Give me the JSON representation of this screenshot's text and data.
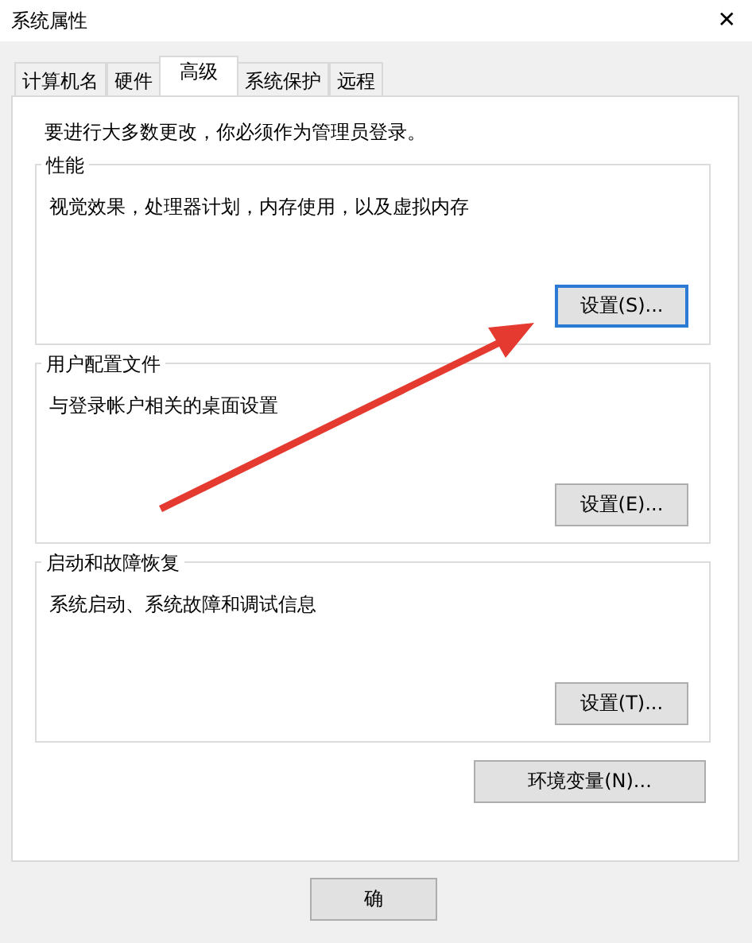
{
  "window": {
    "title": "系统属性",
    "close": "✕"
  },
  "tabs": [
    {
      "label": "计算机名",
      "selected": false
    },
    {
      "label": "硬件",
      "selected": false
    },
    {
      "label": "高级",
      "selected": true
    },
    {
      "label": "系统保护",
      "selected": false
    },
    {
      "label": "远程",
      "selected": false
    }
  ],
  "notice": "要进行大多数更改，你必须作为管理员登录。",
  "groups": [
    {
      "title": "性能",
      "description": "视觉效果，处理器计划，内存使用，以及虚拟内存",
      "button": "设置(S)...",
      "focused": true
    },
    {
      "title": "用户配置文件",
      "description": "与登录帐户相关的桌面设置",
      "button": "设置(E)...",
      "focused": false
    },
    {
      "title": "启动和故障恢复",
      "description": "系统启动、系统故障和调试信息",
      "button": "设置(T)...",
      "focused": false
    }
  ],
  "env_button": "环境变量(N)...",
  "dialog_buttons": [
    "确"
  ]
}
